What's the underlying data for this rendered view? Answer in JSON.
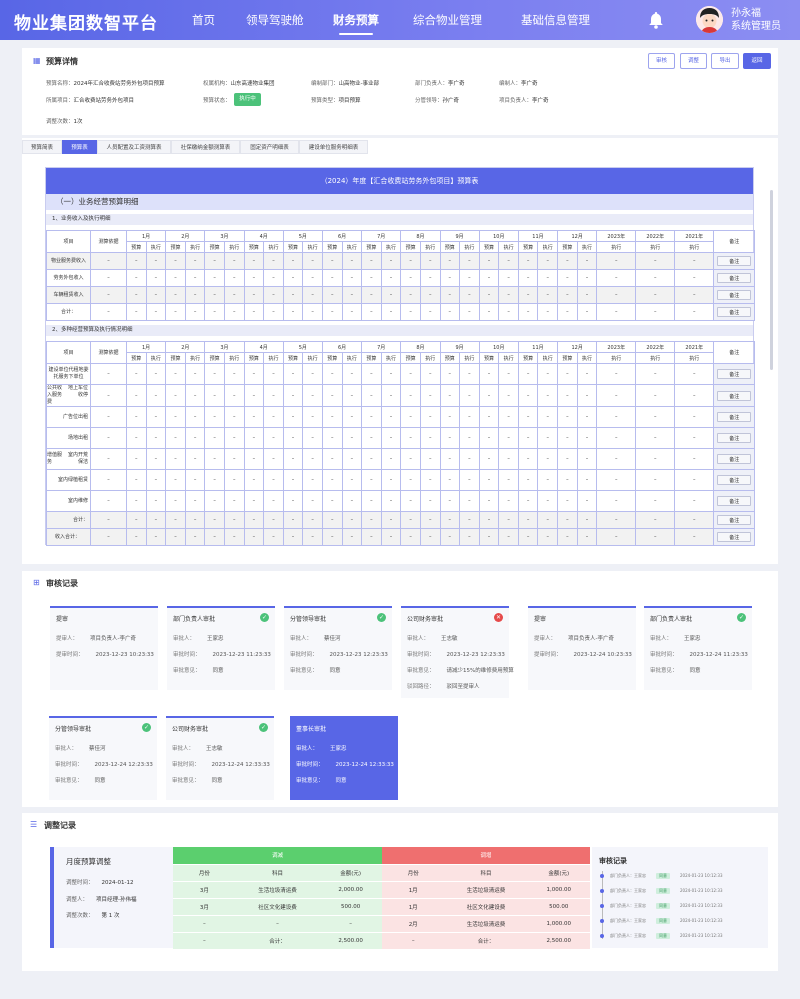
{
  "header": {
    "logo": "物业集团数智平台",
    "nav": [
      "首页",
      "领导驾驶舱",
      "财务预算",
      "综合物业管理",
      "基础信息管理"
    ],
    "active_nav": "财务预算",
    "user_name": "孙永福",
    "user_role": "系统管理员"
  },
  "detail": {
    "title": "预算详情",
    "buttons": [
      "审核",
      "调整",
      "导出",
      "返回"
    ],
    "fields": [
      {
        "k": "预算名称：",
        "v": "2024年汇合收费站劳务外包项目预算"
      },
      {
        "k": "权属机构：",
        "v": "山东高速物业集团"
      },
      {
        "k": "编制部门：",
        "v": "山高物业-事业部"
      },
      {
        "k": "部门负责人：",
        "v": "李广奇"
      },
      {
        "k": "编制人：",
        "v": "李广奇"
      },
      {
        "k": "所属项目：",
        "v": "汇合收费站劳务外包项目"
      },
      {
        "k": "预算状态：",
        "v": "执行中"
      },
      {
        "k": "预算类型：",
        "v": "项目预算"
      },
      {
        "k": "分管领导：",
        "v": "孙广奇"
      },
      {
        "k": "项目负责人：",
        "v": "李广奇"
      },
      {
        "k": "调整次数：",
        "v": "1次"
      }
    ]
  },
  "tabs": [
    "预算简表",
    "预算表",
    "人员配置及工资测算表",
    "社保缴纳金额测算表",
    "固定资产明细表",
    "建设单位服务明细表"
  ],
  "sheet": {
    "title": "（2024）年度【汇合收费站劳务外包项目】预算表",
    "section": "（一）业务经营预算明细",
    "sub1": "1、业务收入及执行明细",
    "sub2": "2、多种经营预算及执行情况明细",
    "col_item": "项目",
    "col_basis": "测算依据",
    "months": [
      "1月",
      "2月",
      "3月",
      "4月",
      "5月",
      "6月",
      "7月",
      "8月",
      "9月",
      "10月",
      "11月",
      "12月"
    ],
    "years": [
      "2023年",
      "2022年",
      "2021年"
    ],
    "col_budget": "预算",
    "col_exec": "执行",
    "col_note": "备注",
    "dash": "–",
    "note_btn": "备注",
    "t1_rows": [
      "物业服务费收入",
      "劳务外包收入",
      "车辆租赁收入",
      "合计："
    ],
    "t2_rows": [
      {
        "g": "",
        "s": "建设单位代租地委托服务下单位"
      },
      {
        "g": "公共收入服务费",
        "s": "地上车位收停"
      },
      {
        "g": "",
        "s": "广告位出租"
      },
      {
        "g": "",
        "s": "场地出租"
      },
      {
        "g": "增值服务",
        "s": "室内开荒保洁"
      },
      {
        "g": "",
        "s": "室内绿植租赁"
      },
      {
        "g": "",
        "s": "室内维修"
      },
      {
        "g": "",
        "s": "合计："
      },
      {
        "g": "收入合计：",
        "s": ""
      }
    ]
  },
  "audit": {
    "title": "审核记录",
    "labels": {
      "submitter": "提审人：",
      "submit_time": "提审时间：",
      "approver": "审批人：",
      "approve_time": "审批时间：",
      "opinion": "审批意见：",
      "reject_path": "驳回路径："
    },
    "cards": [
      {
        "t": "提审",
        "rows": [
          [
            "提审人：",
            "项目负责人-李广奇"
          ],
          [
            "提审时间：",
            "2023-12-23 10:23:33"
          ]
        ],
        "status": ""
      },
      {
        "t": "部门负责人审批",
        "rows": [
          [
            "审批人：",
            "王家忠"
          ],
          [
            "审批时间：",
            "2023-12-23 11:23:33"
          ],
          [
            "审批意见：",
            "同意"
          ]
        ],
        "status": "ok"
      },
      {
        "t": "分管领导审批",
        "rows": [
          [
            "审批人：",
            "蔡佳河"
          ],
          [
            "审批时间：",
            "2023-12-23 12:23:33"
          ],
          [
            "审批意见：",
            "同意"
          ]
        ],
        "status": "ok"
      },
      {
        "t": "公司财务审批",
        "rows": [
          [
            "审批人：",
            "王志敏"
          ],
          [
            "审批时间：",
            "2023-12-23 12:23:33"
          ],
          [
            "审批意见：",
            "请减少15%的维修费用预算"
          ],
          [
            "驳回路径：",
            "驳回至提审人"
          ]
        ],
        "status": "bad"
      },
      {
        "t": "提审",
        "rows": [
          [
            "提审人：",
            "项目负责人-李广奇"
          ],
          [
            "提审时间：",
            "2023-12-24 10:23:33"
          ]
        ],
        "status": ""
      },
      {
        "t": "部门负责人审批",
        "rows": [
          [
            "审批人：",
            "王家忠"
          ],
          [
            "审批时间：",
            "2023-12-24 11:23:33"
          ],
          [
            "审批意见：",
            "同意"
          ]
        ],
        "status": "ok"
      },
      {
        "t": "分管领导审批",
        "rows": [
          [
            "审批人：",
            "蔡佳河"
          ],
          [
            "审批时间：",
            "2023-12-24 12:23:33"
          ],
          [
            "审批意见：",
            "同意"
          ]
        ],
        "status": "ok"
      },
      {
        "t": "公司财务审批",
        "rows": [
          [
            "审批人：",
            "王志敏"
          ],
          [
            "审批时间：",
            "2023-12-24 12:33:33"
          ],
          [
            "审批意见：",
            "同意"
          ]
        ],
        "status": "ok"
      },
      {
        "t": "董事长审批",
        "rows": [
          [
            "审批人：",
            "王家忠"
          ],
          [
            "审批时间：",
            "2023-12-24 12:33:33"
          ],
          [
            "审批意见：",
            "同意"
          ]
        ],
        "status": ""
      }
    ]
  },
  "adjust": {
    "title": "调整记录",
    "panel_title": "月度预算调整",
    "rows": [
      [
        "调整时间：",
        "2024-01-12"
      ],
      [
        "调整人：",
        "项目经理-孙伟福"
      ],
      [
        "调整次数：",
        "第 1 次"
      ]
    ],
    "reduce": {
      "title": "调减",
      "cols": [
        "月份",
        "科目",
        "金额(元)"
      ],
      "rows": [
        [
          "3月",
          "生活垃圾清运费",
          "2,000.00"
        ],
        [
          "3月",
          "社区文化建设费",
          "500.00"
        ],
        [
          "–",
          "–",
          "–"
        ],
        [
          "–",
          "合计：",
          "2,500.00"
        ]
      ]
    },
    "increase": {
      "title": "调增",
      "cols": [
        "月份",
        "科目",
        "金额(元)"
      ],
      "rows": [
        [
          "1月",
          "生活垃圾清运费",
          "1,000.00"
        ],
        [
          "1月",
          "社区文化建设费",
          "500.00"
        ],
        [
          "2月",
          "生活垃圾清运费",
          "1,000.00"
        ],
        [
          "–",
          "合计：",
          "2,500.00"
        ]
      ]
    },
    "audit_title": "审核记录",
    "timeline": [
      [
        "部门负责人：",
        "王家忠",
        "同意",
        "2024-01-23",
        "10:12:33"
      ],
      [
        "部门负责人：",
        "王家忠",
        "同意",
        "2024-01-23",
        "10:12:33"
      ],
      [
        "部门负责人：",
        "王家忠",
        "同意",
        "2024-01-23",
        "10:12:33"
      ],
      [
        "部门负责人：",
        "王家忠",
        "同意",
        "2024-01-23",
        "10:12:33"
      ],
      [
        "部门负责人：",
        "王家忠",
        "同意",
        "2024-01-23",
        "10:12:33"
      ]
    ]
  },
  "colors": {
    "accent": "#5866e6",
    "ok": "#4cc27a",
    "bad": "#e64a4a",
    "reduce_head": "#5bcf6e",
    "reduce_body": "#e1f5e4",
    "increase_head": "#ef6f6f",
    "increase_body": "#fbe3e3"
  }
}
